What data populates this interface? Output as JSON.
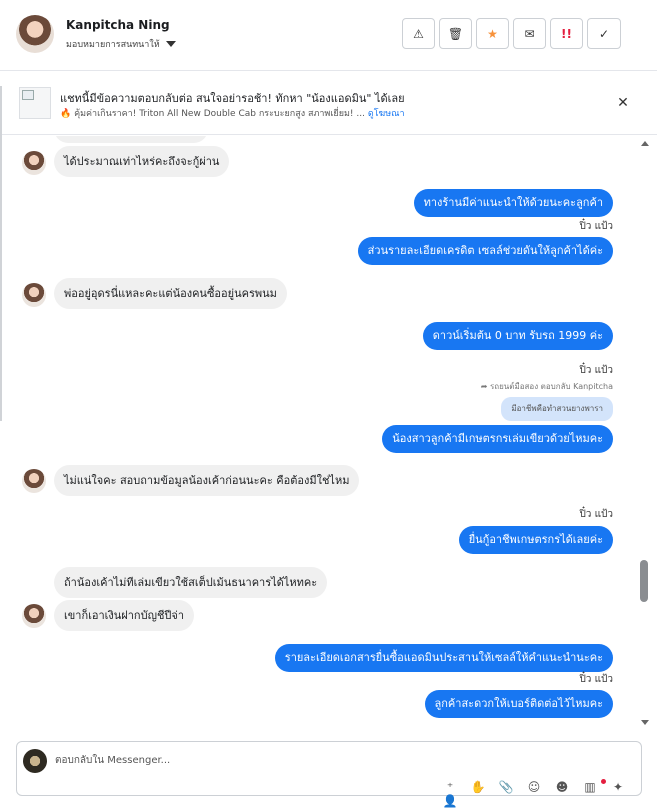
{
  "header": {
    "user_name": "Kanpitcha Ning",
    "assign_label": "มอบหมายการสนทนาให้",
    "actions": [
      {
        "name": "report-icon",
        "glyph": "⚠"
      },
      {
        "name": "trash-icon",
        "glyph": "🗑"
      },
      {
        "name": "star-icon",
        "glyph": "★",
        "color": "#f7923b"
      },
      {
        "name": "mail-icon",
        "glyph": "✉"
      },
      {
        "name": "spam-icon",
        "glyph": "!!",
        "color": "#e41e3f"
      },
      {
        "name": "check-icon",
        "glyph": "✓"
      }
    ]
  },
  "banner": {
    "title": "แชทนี้มีข้อความตอบกลับต่อ สนใจอย่ารอช้า! ทักหา \"น้องแอดมิน\" ได้เลย",
    "subtitle": "🔥 คุ้มค่าเกินราคา! Triton All New Double Cab กระบะยกสูง สภาพเยี่ยม! ...",
    "link": "ดูโฆษณา",
    "close": "✕"
  },
  "messages": {
    "m1": "ได้ประมาณเท่าไหร่คะถึงจะกู้ผ่าน",
    "m2": "ทางร้านมีค่าแนะนำให้ด้วยนะคะลูกค้า",
    "s1": "ปิ๋ว แป้ว",
    "m3": "ส่วนรายละเอียดเครดิต เซลล์ช่วยดันให้ลูกค้าได้ค่ะ",
    "m4": "พ่ออยู่อุดรนี่แหละคะแต่น้องคนซื้ออยู่นครพนม",
    "m5": "ดาวน์เริ่มต้น 0 บาท รับรถ 1999 ค่ะ",
    "s2": "ปิ๋ว แป้ว",
    "reply_note": "➦ รถยนต์มือสอง ตอบกลับ Kanpitcha",
    "quoted": "มีอาชีพคือทำสวนยางพารา",
    "m6": "น้องสาวลูกค้ามีเกษตรกรเล่มเขียวด้วยไหมคะ",
    "m7": "ไม่แน่ใจคะ สอบถามข้อมูลน้องเค้าก่อนนะคะ คือต้องมีใช่ไหม",
    "s3": "ปิ๋ว แป้ว",
    "m8": "ยื่นกู้อาชีพเกษตรกรได้เลยค่ะ",
    "m9": "ถ้าน้องเค้าไม่ทีเล่มเขียวใช้สเต็ปเม้นธนาคารได้ไหทคะ",
    "m10": "เขาก็เอาเงินฝากบัญชีปีจ่า",
    "m11": "รายละเอียดเอกสารยื่นซื้อแอดมินประสานให้เซลล์ให้คำแนะนำนะคะ",
    "s4": "ปิ๋ว แป้ว",
    "m12": "ลูกค้าสะดวกให้เบอร์ติดต่อไว้ไหมคะ"
  },
  "composer": {
    "placeholder": "ตอบกลับใน Messenger...",
    "tools": [
      "add-person-icon",
      "hand-icon",
      "attach-icon",
      "emoji-icon",
      "face-icon",
      "saved-reply-icon",
      "magic-icon"
    ]
  }
}
